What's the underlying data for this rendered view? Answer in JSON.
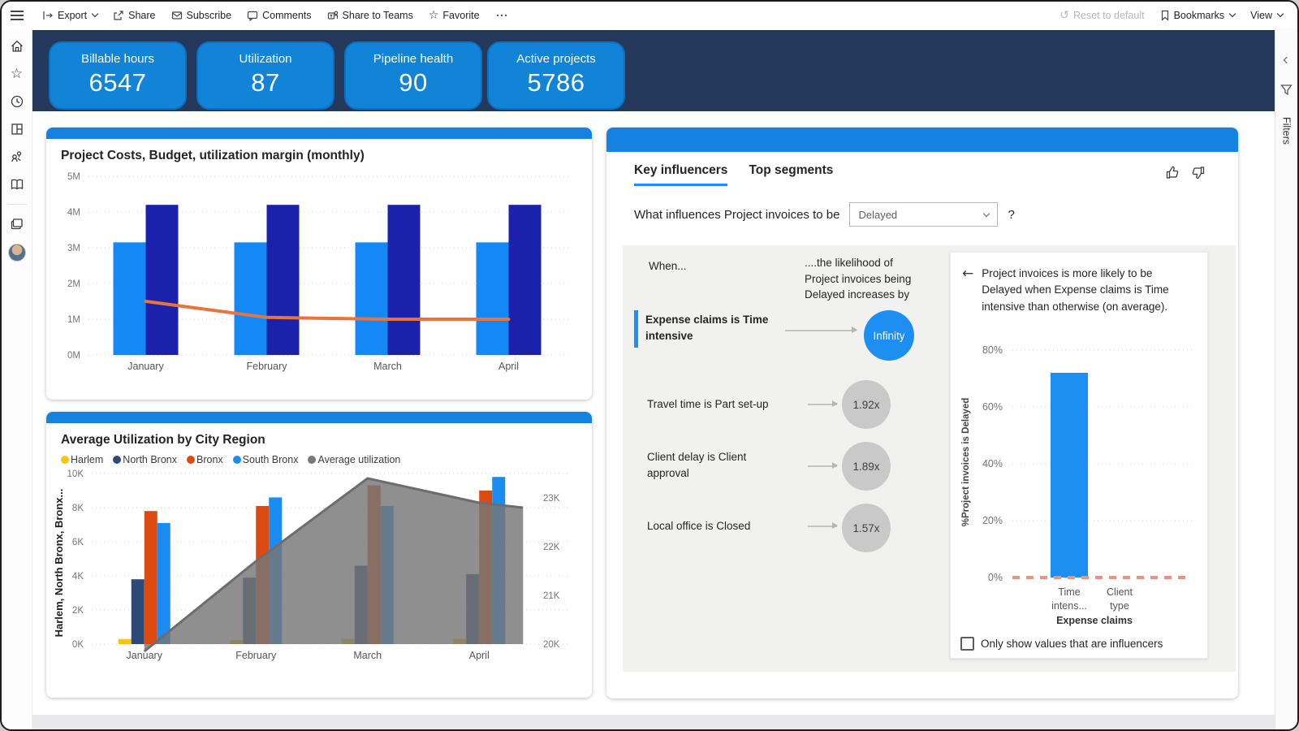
{
  "toolbar": {
    "items": [
      {
        "label": "Export"
      },
      {
        "label": "Share"
      },
      {
        "label": "Subscribe"
      },
      {
        "label": "Comments"
      },
      {
        "label": "Share to Teams"
      },
      {
        "label": "Favorite"
      }
    ],
    "right_items": [
      {
        "label": "Reset to default"
      },
      {
        "label": "Bookmarks"
      },
      {
        "label": "View"
      }
    ]
  },
  "filters_pane": {
    "label": "Filters"
  },
  "kpis": [
    {
      "label": "Billable hours",
      "value": "6547"
    },
    {
      "label": "Utilization",
      "value": "87"
    },
    {
      "label": "Pipeline health",
      "value": "90"
    },
    {
      "label": "Active projects",
      "value": "5786"
    }
  ],
  "key_influencers": {
    "tabs": [
      {
        "label": "Key influencers"
      },
      {
        "label": "Top segments"
      }
    ],
    "question_prefix": "What influences Project invoices to be",
    "dropdown_value": "Delayed",
    "question_suffix": "?",
    "when_label": "When...",
    "likelihood_text": "....the likelihood of Project invoices being Delayed increases by",
    "influencers": [
      {
        "label": "Expense claims is Time intensive",
        "value": "Infinity",
        "selected": true
      },
      {
        "label": "Travel time is Part set-up",
        "value": "1.92x",
        "selected": false
      },
      {
        "label": "Client delay is Client approval",
        "value": "1.89x",
        "selected": false
      },
      {
        "label": "Local office is Closed",
        "value": "1.57x",
        "selected": false
      }
    ],
    "explanation": "Project invoices is more likely to be Delayed when Expense claims is Time intensive than otherwise (on average).",
    "checkbox_label": "Only show values that are influencers",
    "checkbox_checked": false
  },
  "chart_data": [
    {
      "id": "project-costs-monthly",
      "type": "bar",
      "title": "Project Costs, Budget, utilization margin (monthly)",
      "categories": [
        "January",
        "February",
        "March",
        "April"
      ],
      "yticks": [
        "0M",
        "1M",
        "2M",
        "3M",
        "4M",
        "5M"
      ],
      "ylim": [
        0,
        5
      ],
      "grid": true,
      "series": [
        {
          "name": "Project Costs",
          "type": "bar",
          "color": "#1489f5",
          "values": [
            3.15,
            3.15,
            3.15,
            3.15
          ]
        },
        {
          "name": "Budget",
          "type": "bar",
          "color": "#1b21aa",
          "values": [
            4.2,
            4.2,
            4.2,
            4.2
          ]
        },
        {
          "name": "Utilization margin",
          "type": "line",
          "color": "#e8743b",
          "values": [
            1.5,
            1.05,
            1.0,
            1.0
          ]
        }
      ]
    },
    {
      "id": "average-utilization-by-city-region",
      "type": "bar",
      "title": "Average Utilization by City Region",
      "categories": [
        "January",
        "February",
        "March",
        "April"
      ],
      "left_axis": {
        "title": "Harlem, North Bronx, Bronx...",
        "ticks": [
          "0K",
          "2K",
          "4K",
          "6K",
          "8K",
          "10K"
        ],
        "lim": [
          0,
          10
        ]
      },
      "right_axis": {
        "ticks": [
          "20K",
          "21K",
          "22K",
          "23K"
        ],
        "lim": [
          20,
          23.5
        ]
      },
      "grid": true,
      "legend_position": "top",
      "series": [
        {
          "name": "Harlem",
          "type": "bar",
          "color": "#fcc30f",
          "values": [
            0.3,
            0.25,
            0.3,
            0.3
          ]
        },
        {
          "name": "North Bronx",
          "type": "bar",
          "color": "#2c4a77",
          "values": [
            3.8,
            3.9,
            4.6,
            4.1
          ]
        },
        {
          "name": "Bronx",
          "type": "bar",
          "color": "#dc4a0f",
          "values": [
            7.8,
            8.1,
            9.3,
            9.0
          ]
        },
        {
          "name": "South Bronx",
          "type": "bar",
          "color": "#1b8df2",
          "values": [
            7.1,
            8.6,
            8.1,
            9.8
          ]
        },
        {
          "name": "Average utilization",
          "type": "area",
          "axis": "right",
          "color": "#787878",
          "values": [
            19.85,
            21.7,
            23.4,
            22.9
          ]
        }
      ]
    },
    {
      "id": "influencer-detail",
      "type": "bar",
      "categories": [
        "Time intens...",
        "Client type"
      ],
      "values": [
        72,
        0
      ],
      "ylabel": "%Project invoices is Delayed",
      "xlabel": "Expense claims",
      "yticks": [
        "0%",
        "20%",
        "40%",
        "60%",
        "80%"
      ],
      "ylim": [
        0,
        80
      ],
      "grid": true,
      "bar_color": "#1e8ff2",
      "zero_line_color": "#ef9181"
    }
  ]
}
